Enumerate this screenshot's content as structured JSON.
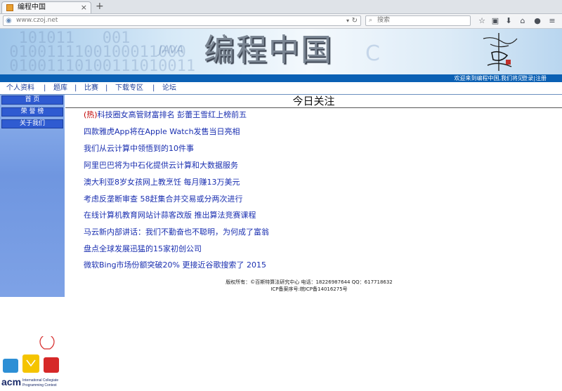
{
  "browser": {
    "tab_title": "编程中国",
    "tab_close": "×",
    "new_tab": "+",
    "url": "www.czoj.net",
    "search_placeholder": "搜索"
  },
  "site": {
    "title": "编程中国",
    "welcome": "欢迎来到编程中国,我们将见",
    "login": "登录|注册"
  },
  "menu": {
    "items": [
      "个人资料",
      "题库",
      "比赛",
      "下载专区",
      "论坛"
    ],
    "separator": "|"
  },
  "sidebar": {
    "items": [
      "首 页",
      "荣 誉 榜",
      "关于我们"
    ]
  },
  "main": {
    "heading": "今日关注",
    "hot_tag": "(热)",
    "news": [
      "科技圈女高管财富排名 彭蕾王雪红上榜前五",
      "四款雅虎App将在Apple Watch发售当日亮相",
      "我们从云计算中领悟到的10件事",
      "阿里巴巴将为中石化提供云计算和大数据服务",
      "澳大利亚8岁女孩网上教烹饪 每月赚13万美元",
      "考虑反垄断审查 58赶集合并交易或分两次进行",
      "在线计算机教育网站计蒜客改版 推出算法竞赛课程",
      "马云新内部讲话：我们不勤奋也不聪明，为何成了富翁",
      "盘点全球发展迅猛的15家初创公司",
      "微软Bing市场份额突破20% 更接近谷歌搜索了 2015"
    ]
  },
  "footer": {
    "line1": "版权所有：©百斯特算法研究中心 电话：18226987644 QQ：617718632",
    "line2": "ICP备案序号:皖ICP备14016275号"
  },
  "acm": {
    "brand": "acm",
    "sub1": "International Collegiate",
    "sub2": "Programming Contest"
  },
  "colors": {
    "nav_blue": "#0a60b4",
    "link_blue": "#1a2fb0",
    "hot_red": "#c00000",
    "sidebar_button": "#2f5bd1"
  }
}
